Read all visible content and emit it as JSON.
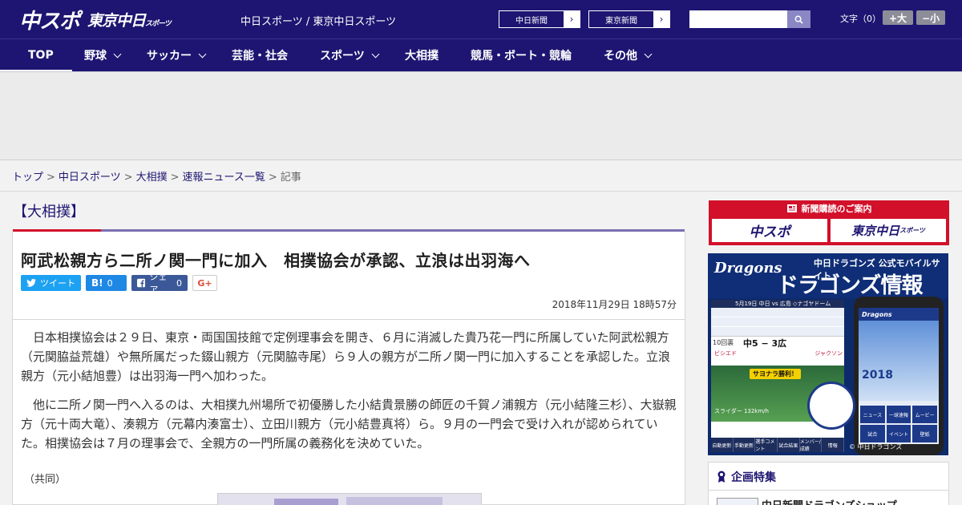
{
  "header": {
    "logo_main": "中スポ",
    "logo_sub": "東京中日",
    "logo_sub_small": "スポーツ",
    "tagline": "中日スポーツ / 東京中日スポーツ",
    "link_chunichi": "中日新聞",
    "link_tokyo": "東京新聞",
    "search_placeholder": "",
    "font_label": "文字（0）",
    "font_large": "+大",
    "font_small": "−小"
  },
  "nav": {
    "items": [
      "TOP",
      "野球",
      "サッカー",
      "芸能・社会",
      "スポーツ",
      "大相撲",
      "競馬・ボート・競輪",
      "その他"
    ]
  },
  "breadcrumb": {
    "items": [
      "トップ",
      "中日スポーツ",
      "大相撲",
      "速報ニュース一覧",
      "記事"
    ],
    "separator": ">"
  },
  "article": {
    "category": "【大相撲】",
    "title": "阿武松親方ら二所ノ関一門に加入　相撲協会が承認、立浪は出羽海へ",
    "share": {
      "tweet_label": "ツイート",
      "hatena_mark": "B!",
      "hatena_count": "0",
      "facebook_label": "シェア",
      "facebook_count": "0",
      "gplus_label": "G+"
    },
    "date": "2018年11月29日 18時57分",
    "paragraphs": [
      "日本相撲協会は２９日、東京・両国国技館で定例理事会を開き、６月に消滅した貴乃花一門に所属していた阿武松親方（元関脇益荒雄）や無所属だった錣山親方（元関脇寺尾）ら９人の親方が二所ノ関一門に加入することを承認した。立浪親方（元小結旭豊）は出羽海一門へ加わった。",
      "他に二所ノ関一門へ入るのは、大相撲九州場所で初優勝した小結貴景勝の師匠の千賀ノ浦親方（元小結隆三杉）、大嶽親方（元十両大竜）、湊親方（元幕内湊富士）、立田川親方（元小結豊真将）ら。９月の一門会で受け入れが認められていた。相撲協会は７月の理事会で、全親方の一門所属の義務化を決めていた。"
    ],
    "credit": "（共同）"
  },
  "sidebar": {
    "subscribe_title": "新聞購読のご案内",
    "subscribe_logo_1": "中スポ",
    "subscribe_logo_2": "東京中日",
    "subscribe_logo_2_small": "スポーツ",
    "dragons": {
      "brand": "Dragons",
      "caption": "中日ドラゴンズ 公式モバイルサイト",
      "headline": "ドラゴンズ情報",
      "score_bar": "5月19日 中日 vs 広島 ◇ナゴヤドーム",
      "innings": "10回裏",
      "score": "中5 − 3広",
      "player_left": "ビシエド",
      "player_right": "ジャクソン",
      "sayonara": "サヨナラ勝利！",
      "pitch": "スライダー 132km/h",
      "menu": [
        "自動更新",
        "手動更新",
        "選手コメント",
        "試合結果",
        "メンバー/成績",
        "情報"
      ],
      "phone_brand": "Dragons",
      "year": "2018",
      "tiles": [
        "ニュース",
        "一球速報",
        "ムービー",
        "試合",
        "イベント",
        "壁紙"
      ],
      "footer": "© 中日ドラゴンズ"
    },
    "feature_title": "企画特集",
    "feature_item": "中日新聞ドラゴンズショップ"
  },
  "colors": {
    "brand_navy": "#1d1571",
    "accent_red": "#d2102a",
    "accent_purple": "#7a6fb0"
  }
}
